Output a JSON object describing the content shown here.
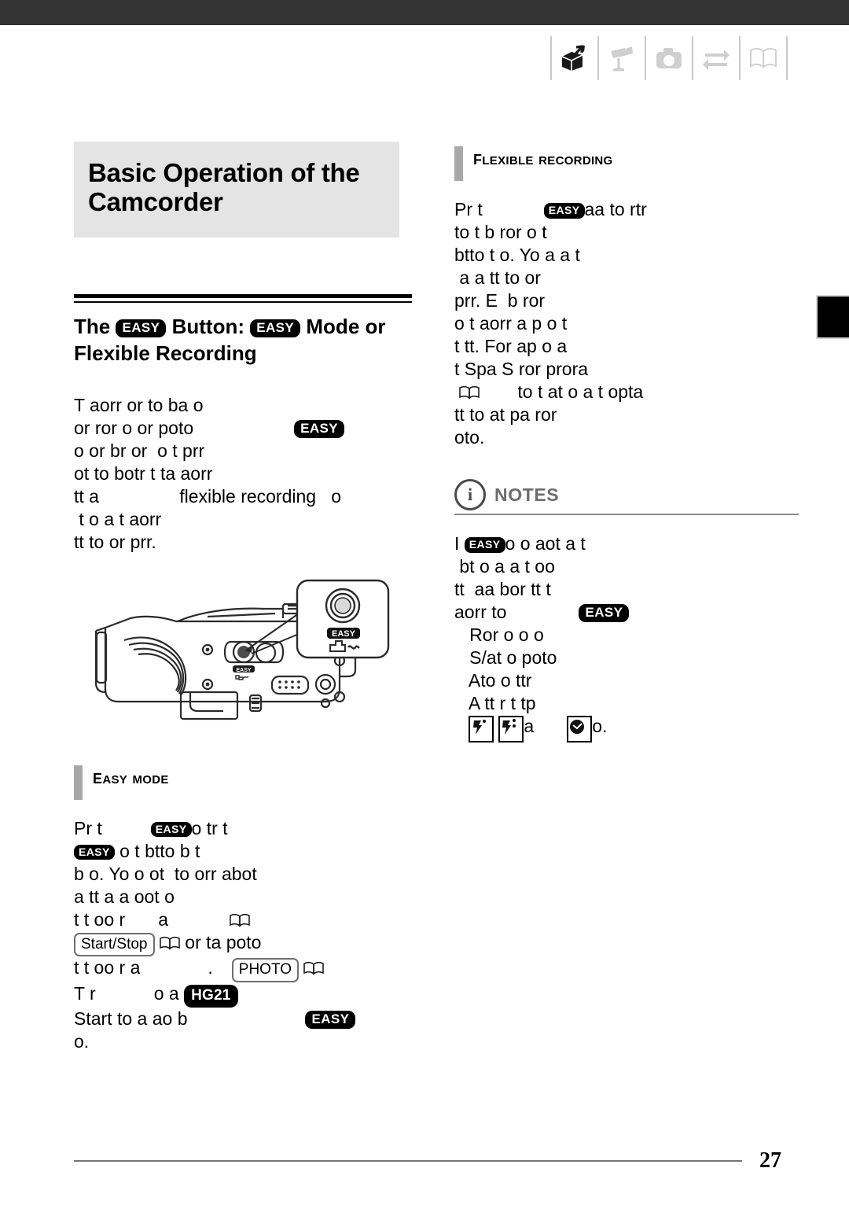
{
  "header": {
    "tabs": [
      {
        "name": "getting-started-box-icon",
        "label": "box-arrow-icon",
        "active": true
      },
      {
        "name": "video-recording-icon",
        "label": "camcorder-icon",
        "active": false
      },
      {
        "name": "photo-recording-icon",
        "label": "camera-icon",
        "active": false
      },
      {
        "name": "external-connections-icon",
        "label": "exchange-arrows-icon",
        "active": false
      },
      {
        "name": "additional-information-icon",
        "label": "open-book-icon",
        "active": false
      }
    ]
  },
  "chapter": {
    "title_line1": "Basic Operation of the",
    "title_line2": "Camcorder"
  },
  "section": {
    "heading_pre": "The",
    "heading_badge1": "EASY",
    "heading_mid": "Button:",
    "heading_badge2": "EASY",
    "heading_post": "Mode or",
    "heading_line2": "Flexible Recording",
    "intro_lines": [
      "T aorr or to ba o",
      "or ror o or poto",
      "o or br or  o t prr",
      "ot to botr t ta aorr",
      "tt a                flexible recording   o",
      " t o a t aorr",
      "tt to or prr."
    ],
    "intro_badge": "EASY"
  },
  "illustration": {
    "name": "camcorder-side-view",
    "callout_badge": "EASY",
    "callout_icon": "print-wave-icon",
    "body_badge": "EASY"
  },
  "easy_mode": {
    "title": "EASY MODE",
    "lines": [
      "Pr t           EASY  o tr t",
      "EASY  o t btto b t",
      "b o. Yo o ot  to orr abot",
      "a tt a a oot o",
      "t t oo r       a              BOOK",
      "START/STOP  BOOK or ta poto",
      "t t oo r a                 .     PHOTO   BOOK",
      "T r            o a   HG21",
      "Start to a ao b                    EASY",
      "o."
    ],
    "badge_startstop": "Start/Stop",
    "badge_photo": "PHOTO",
    "badge_hg21": "HG21",
    "badge_easy": "EASY"
  },
  "flexible_recording": {
    "title": "FLEXIBLE RECORDING",
    "lines": [
      "Pr t            EASY aa to rtr",
      "to t b ror o t",
      "btto t o. Yo a a t",
      " a a tt to or",
      "prr. E  b ror",
      "o t aorr a p o t",
      "t tt. For ap o a",
      "t Spa S ror prora",
      " BOOK      to t at o a t opta",
      "tt to at pa ror",
      "oto."
    ],
    "badge_easy": "EASY"
  },
  "notes": {
    "label": "NOTES",
    "icon": "info-circle-icon",
    "lines": [
      "I   EASY o o aot a t",
      " bt o a a t oo",
      "tt  aa bor tt t",
      "aorr to          EASY",
      "   Ror o o o",
      "   S/at o poto",
      "   Ato o ttr",
      "   A tt r t tp",
      "    ICON1   ICON2 a    ICON3 o."
    ],
    "badge_easy": "EASY",
    "icons": [
      "scene-mode-icon",
      "scene-mode-multi-icon",
      "dial-clock-icon"
    ]
  },
  "footer": {
    "page_number": "27"
  }
}
